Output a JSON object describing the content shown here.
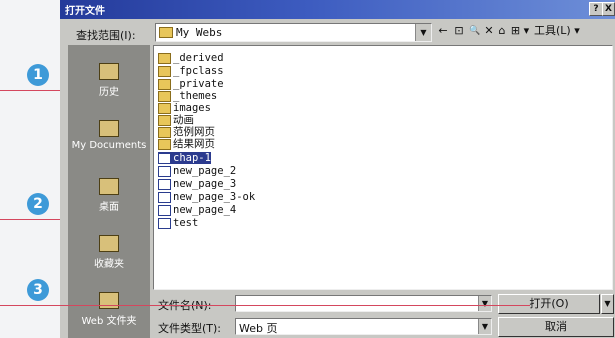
{
  "dialog": {
    "title": "打开文件",
    "help": "?",
    "close": "X"
  },
  "toolbar": {
    "lookin_label": "查找范围(I):",
    "lookin_value": "My Webs",
    "back": "←",
    "up": "⊡",
    "search": "🔍",
    "delete": "✕",
    "newfolder": "⌂",
    "views": "⊞ ▾",
    "tools": "工具(L) ▾"
  },
  "places": [
    {
      "label": "历史"
    },
    {
      "label": "My Documents"
    },
    {
      "label": "桌面"
    },
    {
      "label": "收藏夹"
    },
    {
      "label": "Web 文件夹"
    }
  ],
  "files": [
    {
      "name": "_derived",
      "kind": "folder"
    },
    {
      "name": "_fpclass",
      "kind": "folder"
    },
    {
      "name": "_private",
      "kind": "folder"
    },
    {
      "name": "_themes",
      "kind": "folder"
    },
    {
      "name": "images",
      "kind": "folder"
    },
    {
      "name": "动画",
      "kind": "folder"
    },
    {
      "name": "范例网页",
      "kind": "folder"
    },
    {
      "name": "结果网页",
      "kind": "folder"
    },
    {
      "name": "chap-1",
      "kind": "page",
      "selected": true
    },
    {
      "name": "new_page_2",
      "kind": "page"
    },
    {
      "name": "new_page_3",
      "kind": "page"
    },
    {
      "name": "new_page_3-ok",
      "kind": "page"
    },
    {
      "name": "new_page_4",
      "kind": "page"
    },
    {
      "name": "test",
      "kind": "page"
    }
  ],
  "bottom": {
    "filename_label": "文件名(N):",
    "filename_value": "",
    "filetype_label": "文件类型(T):",
    "filetype_value": "Web 页",
    "open_button": "打开(O)",
    "cancel_button": "取消"
  },
  "callouts": [
    "1",
    "2",
    "3"
  ]
}
